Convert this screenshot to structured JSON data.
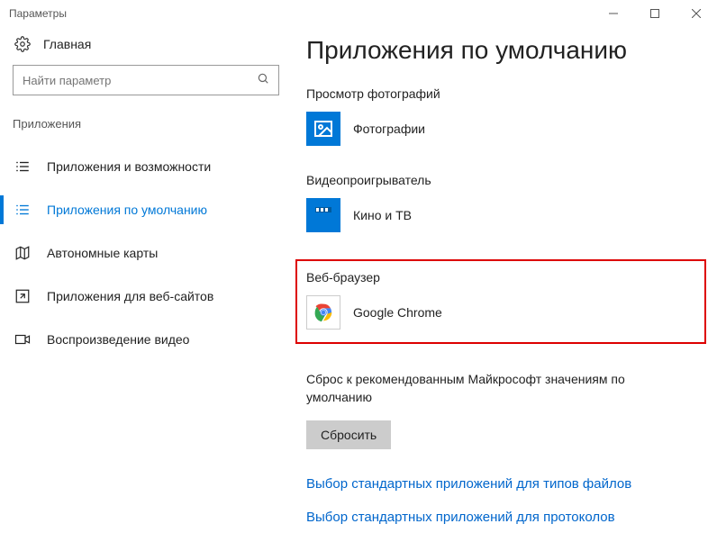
{
  "window": {
    "title": "Параметры"
  },
  "sidebar": {
    "home": "Главная",
    "search_placeholder": "Найти параметр",
    "section": "Приложения",
    "items": [
      {
        "label": "Приложения и возможности"
      },
      {
        "label": "Приложения по умолчанию"
      },
      {
        "label": "Автономные карты"
      },
      {
        "label": "Приложения для веб-сайтов"
      },
      {
        "label": "Воспроизведение видео"
      }
    ]
  },
  "main": {
    "heading": "Приложения по умолчанию",
    "categories": [
      {
        "label": "Просмотр фотографий",
        "app": "Фотографии"
      },
      {
        "label": "Видеопроигрыватель",
        "app": "Кино и ТВ"
      },
      {
        "label": "Веб-браузер",
        "app": "Google Chrome"
      }
    ],
    "reset": {
      "label": "Сброс к рекомендованным Майкрософт значениям по умолчанию",
      "button": "Сбросить"
    },
    "links": [
      "Выбор стандартных приложений для типов файлов",
      "Выбор стандартных приложений для протоколов"
    ]
  }
}
